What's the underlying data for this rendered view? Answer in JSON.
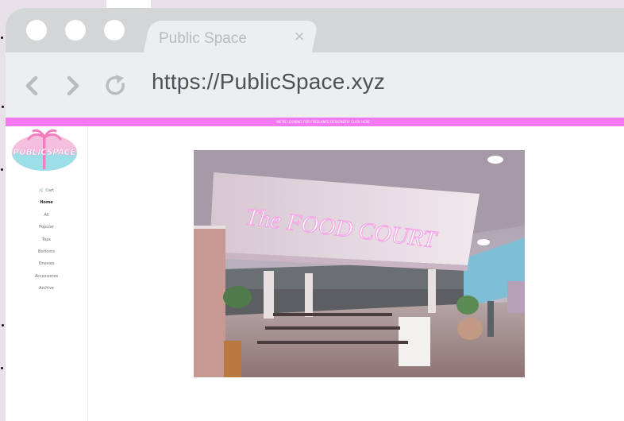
{
  "browser": {
    "tab_title": "Public Space",
    "tab_close": "×",
    "url": "https://PublicSpace.xyz"
  },
  "banner": {
    "text": "WE'RE LOOKING FOR FREELANCE DESIGNERS! CLICK HERE"
  },
  "site": {
    "logo_text": "PUBLICSPACE",
    "cart_label": "Cart",
    "nav": [
      "Home",
      "All",
      "Popular",
      "Tops",
      "Bottoms",
      "Onesies",
      "Accessories",
      "Archive"
    ],
    "active_nav": "Home"
  },
  "hero": {
    "sign_text": "The FOOD COURT"
  },
  "colors": {
    "banner": "#f279f0",
    "browser_chrome": "#d3d5d6",
    "toolbar": "#eceeef",
    "page_bg": "#e9e1ea"
  }
}
